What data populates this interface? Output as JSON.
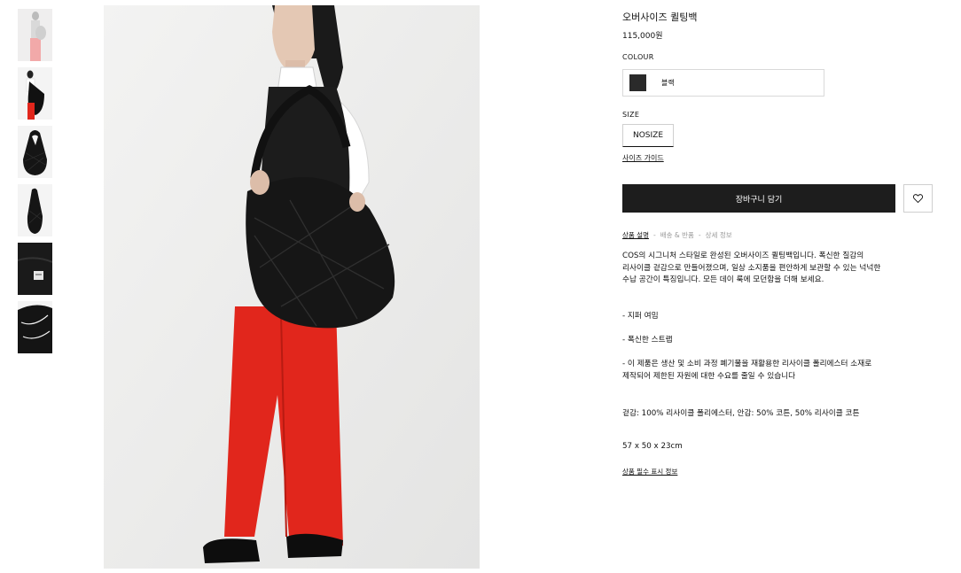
{
  "thumbnails": [
    {
      "name": "thumb-model-front"
    },
    {
      "name": "thumb-model-side"
    },
    {
      "name": "thumb-bag-front"
    },
    {
      "name": "thumb-bag-side"
    },
    {
      "name": "thumb-bag-interior"
    },
    {
      "name": "thumb-bag-detail"
    }
  ],
  "product": {
    "title": "오버사이즈 퀼팅백",
    "price": "115,000원",
    "colour_label": "COLOUR",
    "colour_name": "블랙",
    "swatch_color": "#2a2a2a",
    "size_label": "SIZE",
    "size_value": "NOSIZE",
    "size_guide": "사이즈 가이드",
    "add_to_cart": "장바구니 담기",
    "wishlist_icon": "heart-icon"
  },
  "tabs": {
    "items": [
      "상품 설명",
      "배송 & 반품",
      "상세 정보"
    ],
    "separator": "-"
  },
  "description": {
    "lines": [
      "COS의 시그니처 스타일로 완성된 오버사이즈 퀼팅백입니다. 폭신한 질감의",
      "리사이클 겉감으로 만들어졌으며, 일상 소지품을 편안하게 보관할 수 있는 넉넉한",
      "수납 공간이 특징입니다. 모든 데이 룩에 모던함을 더해 보세요."
    ],
    "bullet1": "- 지퍼 여밈",
    "bullet2": "- 폭신한 스트랩",
    "bullet3_line1": "- 이 제품은 생산 및 소비 과정 폐기물을 재활용한 리사이클 폴리에스터 소재로",
    "bullet3_line2": "제작되어 제한된 자원에 대한 수요를 줄일 수 있습니다",
    "material": "겉감: 100% 리사이클 폴리에스터, 안감: 50% 코튼, 50% 리사이클 코튼",
    "dimensions": "57 x 50 x 23cm",
    "mandatory_info": "상품 필수 표시 정보"
  },
  "colors": {
    "accent_button": "#1d1d1d",
    "trousers": "#e1261c",
    "background": "#ececeb"
  }
}
